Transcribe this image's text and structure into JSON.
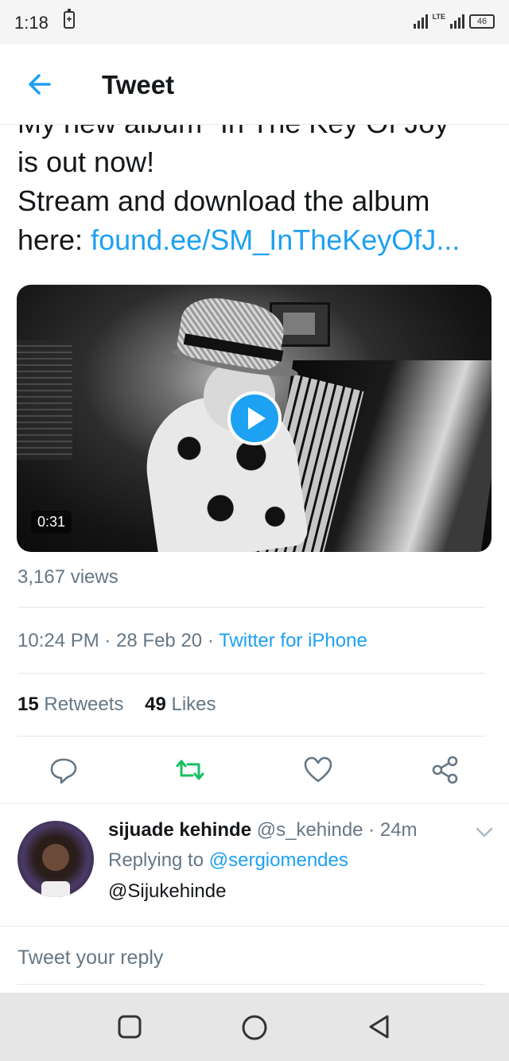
{
  "status_bar": {
    "time": "1:18",
    "battery_saver_glyph": "+",
    "network": "LTE",
    "battery": "46"
  },
  "app_bar": {
    "title": "Tweet",
    "back_icon": "arrow-left-icon"
  },
  "tweet": {
    "text_line_partial": "My new album \"In The Key Of Joy\"",
    "text_line_1": "is out now!",
    "text_line_2": "Stream and download the album",
    "text_line_3_prefix": "here: ",
    "link": "found.ee/SM_InTheKeyOfJ...",
    "media": {
      "duration": "0:31",
      "play_icon": "play-icon"
    },
    "views": "3,167 views",
    "time": "10:24 PM",
    "date": "28 Feb 20",
    "source": "Twitter for iPhone",
    "retweets_count": "15",
    "retweets_label": "Retweets",
    "likes_count": "49",
    "likes_label": "Likes"
  },
  "actions": [
    "reply-icon",
    "retweet-icon",
    "like-icon",
    "share-icon"
  ],
  "reply": {
    "display_name": "sijuade kehinde",
    "handle": "@s_kehinde",
    "age": "24m",
    "replying_prefix": "Replying to ",
    "replying_handle": "@sergiomendes",
    "text": "@Sijukehinde"
  },
  "composer": {
    "placeholder": "Tweet your reply"
  },
  "nav": [
    "recents-icon",
    "home-icon",
    "back-icon"
  ],
  "colors": {
    "accent": "#1da1f2",
    "retweeted": "#17bf63",
    "secondary_text": "#657786"
  }
}
